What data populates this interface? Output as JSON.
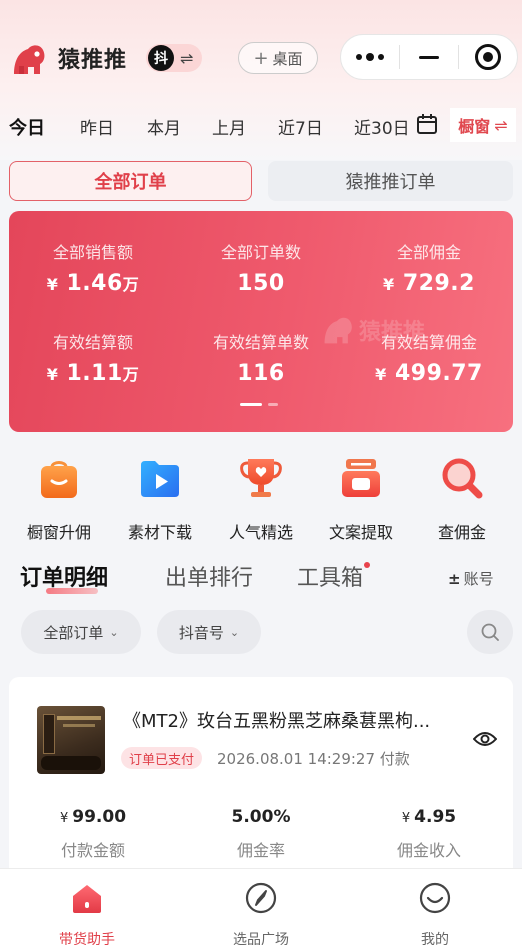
{
  "app": {
    "name": "猿推推",
    "platform_badge": "抖",
    "swap_symbol": "⇌"
  },
  "header": {
    "desk_button": "桌面",
    "desk_plus": "+"
  },
  "date_tabs": [
    "今日",
    "昨日",
    "本月",
    "上月",
    "近7日",
    "近30日"
  ],
  "date_tabs_active": "今日",
  "window_tab": "橱窗",
  "order_tabs": {
    "all": "全部订单",
    "yuantuitui": "猿推推订单",
    "active": "全部订单"
  },
  "stats": {
    "watermark": "猿推推",
    "items": [
      {
        "label": "全部销售额",
        "currency": "¥",
        "value": "1.46",
        "unit": "万"
      },
      {
        "label": "全部订单数",
        "currency": "",
        "value": "150",
        "unit": ""
      },
      {
        "label": "全部佣金",
        "currency": "¥",
        "value": "729.2",
        "unit": ""
      },
      {
        "label": "有效结算额",
        "currency": "¥",
        "value": "1.11",
        "unit": "万"
      },
      {
        "label": "有效结算单数",
        "currency": "",
        "value": "116",
        "unit": ""
      },
      {
        "label": "有效结算佣金",
        "currency": "¥",
        "value": "499.77",
        "unit": ""
      }
    ],
    "page": 1,
    "pages": 2
  },
  "tools": [
    {
      "label": "橱窗升佣",
      "icon": "shop-bag-icon"
    },
    {
      "label": "素材下载",
      "icon": "folder-play-icon"
    },
    {
      "label": "人气精选",
      "icon": "trophy-heart-icon"
    },
    {
      "label": "文案提取",
      "icon": "video-text-icon"
    },
    {
      "label": "查佣金",
      "icon": "magnifier-icon"
    }
  ],
  "section_tabs": [
    "订单明细",
    "出单排行",
    "工具箱"
  ],
  "section_active": "订单明细",
  "account": {
    "symbol": "±",
    "label": "账号"
  },
  "filters": {
    "order_filter": "全部订单",
    "account_filter": "抖音号"
  },
  "order": {
    "title": "《MT2》玫台五黑粉黑芝麻桑葚黑枸...",
    "status": "订单已支付",
    "time": "2026.08.01 14:29:27 付款",
    "metrics": [
      {
        "prefix": "¥",
        "value": "99.00",
        "label": "付款金额"
      },
      {
        "prefix": "",
        "value": "5.00%",
        "label": "佣金率"
      },
      {
        "prefix": "¥",
        "value": "4.95",
        "label": "佣金收入"
      }
    ]
  },
  "bottom_nav": [
    {
      "label": "带货助手",
      "icon": "home-icon",
      "active": true
    },
    {
      "label": "选品广场",
      "icon": "compass-icon",
      "active": false
    },
    {
      "label": "我的",
      "icon": "smile-icon",
      "active": false
    }
  ],
  "colors": {
    "brand": "#e0404a",
    "card_gradient_start": "#e4465a",
    "card_gradient_end": "#f7707f"
  }
}
